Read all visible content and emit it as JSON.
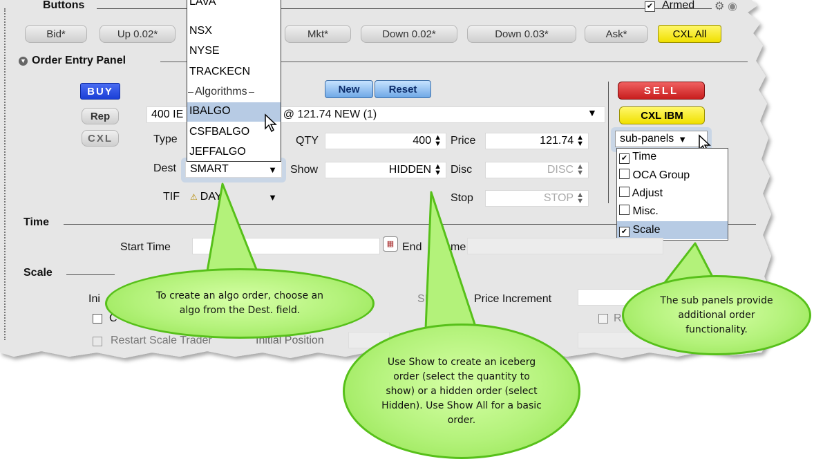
{
  "buttons_section": {
    "title": "Buttons",
    "armed_label": "Armed",
    "buttons": [
      "Bid*",
      "Up 0.02*",
      "Mkt*",
      "Down 0.02*",
      "Down 0.03*",
      "Ask*"
    ],
    "cxl_all": "CXL All"
  },
  "order_entry": {
    "title": "Order Entry Panel",
    "buy": "BUY",
    "rep": "Rep",
    "cxl": "CXL",
    "new": "New",
    "reset": "Reset",
    "sell": "SELL",
    "cxl_ibm": "CXL IBM",
    "order_desc_left": "400 IE",
    "order_desc_right": ") @ 121.74 NEW (1)",
    "type_label": "Type",
    "dest_label": "Dest",
    "dest_value": "SMART",
    "tif_label": "TIF",
    "tif_value": "DAY",
    "qty_label": "QTY",
    "qty_value": "400",
    "show_label": "Show",
    "show_value": "HIDDEN",
    "price_label": "Price",
    "price_value": "121.74",
    "disc_label": "Disc",
    "disc_placeholder": "DISC",
    "stop_label": "Stop",
    "stop_placeholder": "STOP",
    "sub_panels_label": "sub-panels"
  },
  "dest_dropdown": {
    "items": [
      "LAVA",
      "NSX",
      "NYSE",
      "TRACKECN"
    ],
    "algo_header": "Algorithms",
    "algo_items": [
      "IBALGO",
      "CSFBALGO",
      "JEFFALGO"
    ],
    "selected": "IBALGO"
  },
  "sub_panels_menu": {
    "items": [
      {
        "label": "Time",
        "checked": true
      },
      {
        "label": "OCA Group",
        "checked": false
      },
      {
        "label": "Adjust",
        "checked": false
      },
      {
        "label": "Misc.",
        "checked": false
      },
      {
        "label": "Scale",
        "checked": true
      }
    ]
  },
  "time_section": {
    "title": "Time",
    "start_label": "Start Time",
    "end_label_a": "End",
    "end_label_b": "me"
  },
  "scale_section": {
    "title": "Scale",
    "ini_label": "Ini",
    "si_label": "SI",
    "price_increment_label": "Price Increment",
    "restart_label": "Restart Scale Trader",
    "initial_position_label": "Initial Position",
    "c_label": "C",
    "r_label": "R"
  },
  "callouts": {
    "algo": "To create an algo order, choose an algo from the Dest. field.",
    "show": "Use Show to create an iceberg order (select the quantity to show) or a hidden order (select Hidden). Use Show All for a basic order.",
    "subpanels": "The sub panels provide additional order functionality."
  },
  "colors": {
    "buy_blue": "#1a3fd6",
    "sell_red": "#c81e1e",
    "accent_yellow": "#f6ee00",
    "callout_green": "#b3f27a"
  }
}
